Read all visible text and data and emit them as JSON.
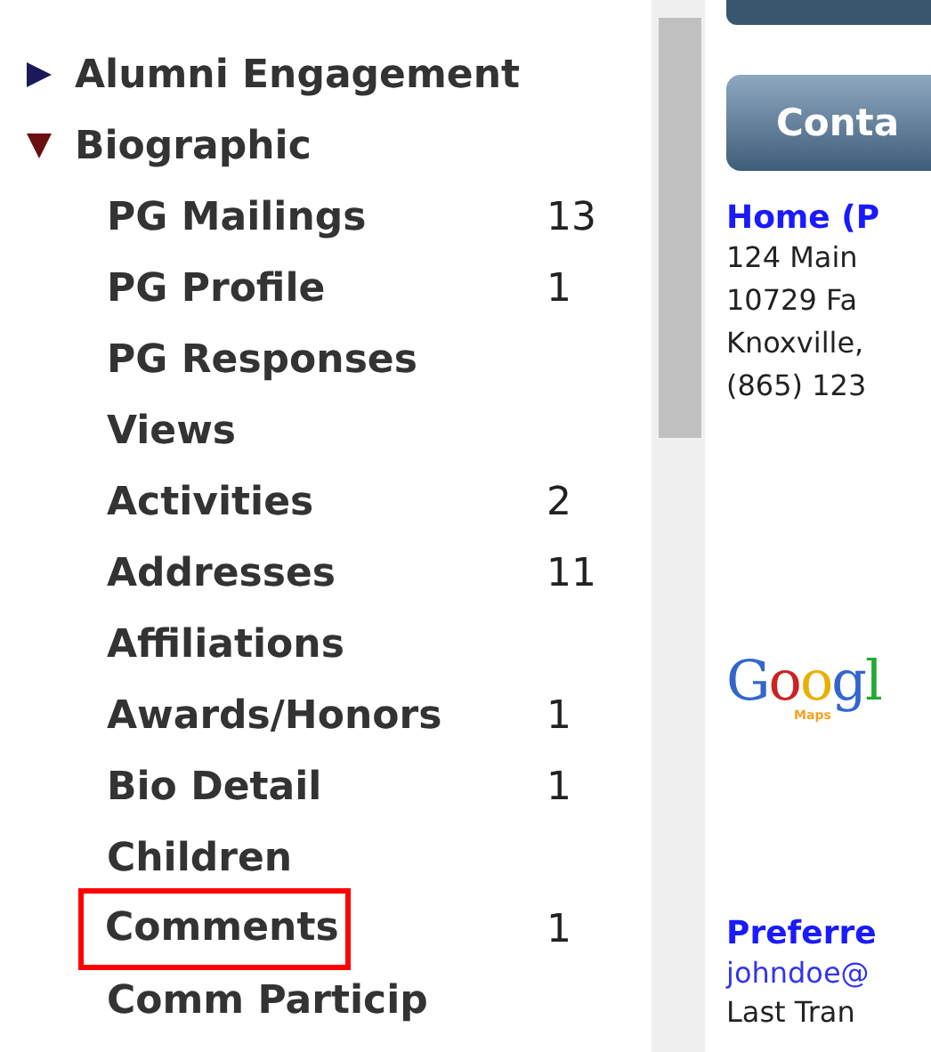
{
  "nav": [
    {
      "label": "Alumni Engagement",
      "expanded": false
    },
    {
      "label": "Biographic",
      "expanded": true,
      "children": [
        {
          "label": "PG Mailings",
          "count": "13",
          "highlighted": false
        },
        {
          "label": "PG Profile",
          "count": "1",
          "highlighted": false
        },
        {
          "label": "PG Responses",
          "highlighted": false
        },
        {
          "label": "Views",
          "highlighted": false
        },
        {
          "label": "Activities",
          "count": "2",
          "highlighted": false
        },
        {
          "label": "Addresses",
          "count": "11",
          "highlighted": false
        },
        {
          "label": "Affiliations",
          "highlighted": false
        },
        {
          "label": "Awards/Honors",
          "count": "1",
          "highlighted": false
        },
        {
          "label": "Bio Detail",
          "count": "1",
          "highlighted": false
        },
        {
          "label": "Children",
          "highlighted": false
        },
        {
          "label": "Comments",
          "count": "1",
          "highlighted": true
        },
        {
          "label": "Comm Particip",
          "highlighted": false
        }
      ]
    }
  ],
  "contact": {
    "button": "Conta",
    "heading": "Home (P",
    "address_lines": [
      "124 Main",
      "10729 Fa",
      "Knoxville,",
      "(865) 123"
    ],
    "map_logo": {
      "name": "Googl",
      "sub": "Maps"
    },
    "preferred_heading": "Preferre",
    "email": "johndoe@",
    "last_line": "Last Tran"
  }
}
